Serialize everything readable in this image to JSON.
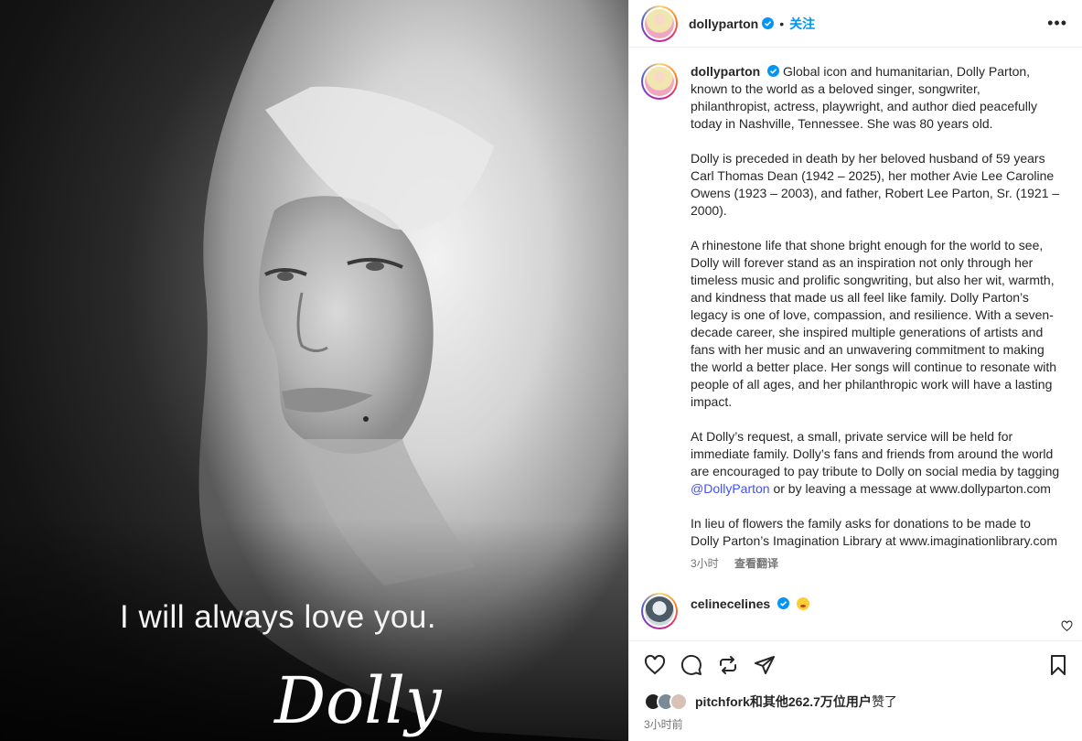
{
  "image": {
    "quote": "I will always love you.",
    "signature": "Dolly"
  },
  "header": {
    "username": "dollyparton",
    "separator": "•",
    "follow_label": "关注",
    "more_label": "•••"
  },
  "caption": {
    "username": "dollyparton",
    "paragraphs": [
      "Global icon and humanitarian, Dolly Parton, known to the world as a beloved singer, songwriter, philanthropist, actress, playwright, and author died peacefully today in Nashville, Tennessee. She was 80 years old.",
      "Dolly is preceded in death by her beloved husband of 59 years Carl Thomas Dean (1942 – 2025), her mother Avie Lee Caroline Owens (1923 – 2003), and father, Robert Lee Parton, Sr. (1921 – 2000).",
      "A rhinestone life that shone bright enough for the world to see, Dolly will forever stand as an inspiration not only through her timeless music and prolific songwriting, but also her wit, warmth, and kindness that made us all feel like family. Dolly Parton’s legacy is one of love, compassion, and resilience. With a seven-decade career, she inspired multiple generations of artists and fans with her music and an unwavering commitment to making the world a better place. Her songs will continue to resonate with people of all ages, and her philanthropic work will have a lasting impact."
    ],
    "p4_before": "At Dolly’s request, a small, private service will be held for immediate family. Dolly’s fans and friends from around the world are encouraged to pay tribute to Dolly on social media by tagging ",
    "p4_mention": "@DollyParton",
    "p4_after": " or by leaving a message at www.dollyparton.com",
    "p5": "In lieu of flowers the family asks for donations to be made to Dolly Parton’s Imagination Library at www.imaginationlibrary.com",
    "time": "3小时",
    "translate_label": "查看翻译"
  },
  "comment": {
    "username": "celinecelines"
  },
  "likes": {
    "first_user": "pitchfork",
    "and_others": "和其他262.7万位用户",
    "suffix": "赞了"
  },
  "post_time": "3小时前"
}
